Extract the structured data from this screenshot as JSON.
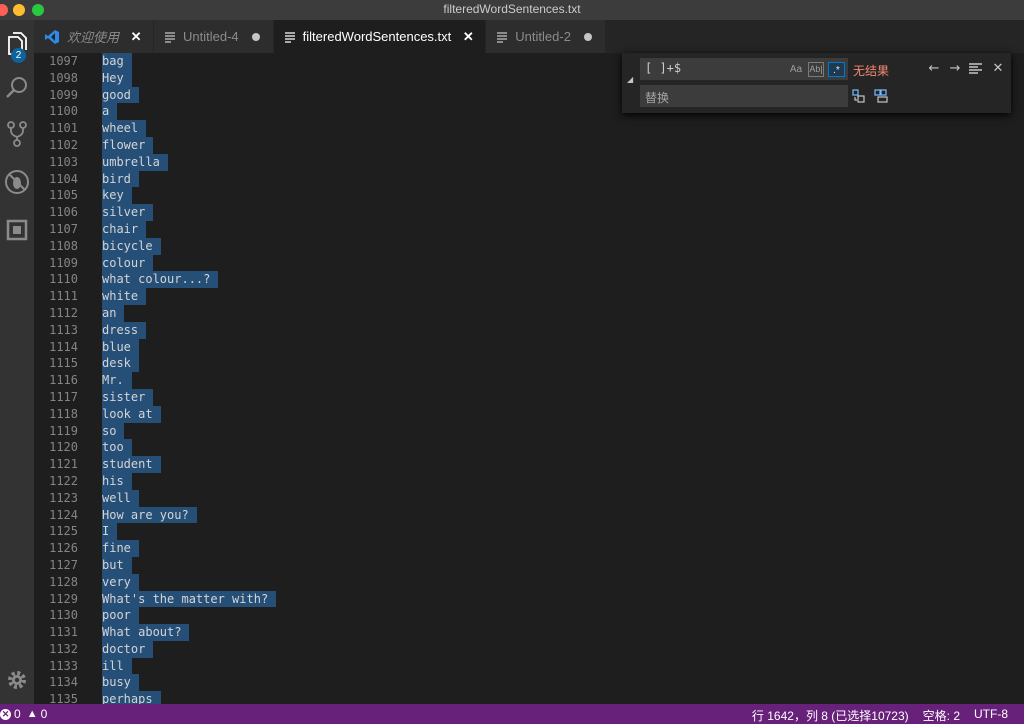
{
  "window": {
    "title": "filteredWordSentences.txt"
  },
  "activity_bar": {
    "explorer_badge": "2"
  },
  "tabs": [
    {
      "label": "欢迎使用",
      "icon": "vscode-logo-icon",
      "state": "close",
      "italic": true
    },
    {
      "label": "Untitled-4",
      "icon": "file-lines-icon",
      "state": "dirty"
    },
    {
      "label": "filteredWordSentences.txt",
      "icon": "file-lines-icon",
      "state": "close",
      "active": true
    },
    {
      "label": "Untitled-2",
      "icon": "file-lines-icon",
      "state": "dirty"
    }
  ],
  "editor": {
    "lines": [
      {
        "n": "1097",
        "text": "bag"
      },
      {
        "n": "1098",
        "text": "Hey"
      },
      {
        "n": "1099",
        "text": "good"
      },
      {
        "n": "1100",
        "text": "a"
      },
      {
        "n": "1101",
        "text": "wheel"
      },
      {
        "n": "1102",
        "text": "flower"
      },
      {
        "n": "1103",
        "text": "umbrella"
      },
      {
        "n": "1104",
        "text": "bird"
      },
      {
        "n": "1105",
        "text": "key"
      },
      {
        "n": "1106",
        "text": "silver"
      },
      {
        "n": "1107",
        "text": "chair"
      },
      {
        "n": "1108",
        "text": "bicycle"
      },
      {
        "n": "1109",
        "text": "colour"
      },
      {
        "n": "1110",
        "text": "what colour...?"
      },
      {
        "n": "1111",
        "text": "white"
      },
      {
        "n": "1112",
        "text": "an"
      },
      {
        "n": "1113",
        "text": "dress"
      },
      {
        "n": "1114",
        "text": "blue"
      },
      {
        "n": "1115",
        "text": "desk"
      },
      {
        "n": "1116",
        "text": "Mr."
      },
      {
        "n": "1117",
        "text": "sister"
      },
      {
        "n": "1118",
        "text": "look at"
      },
      {
        "n": "1119",
        "text": "so"
      },
      {
        "n": "1120",
        "text": "too"
      },
      {
        "n": "1121",
        "text": "student"
      },
      {
        "n": "1122",
        "text": "his"
      },
      {
        "n": "1123",
        "text": "well"
      },
      {
        "n": "1124",
        "text": "How are you?"
      },
      {
        "n": "1125",
        "text": "I"
      },
      {
        "n": "1126",
        "text": "fine"
      },
      {
        "n": "1127",
        "text": "but"
      },
      {
        "n": "1128",
        "text": "very"
      },
      {
        "n": "1129",
        "text": "What's the matter with?"
      },
      {
        "n": "1130",
        "text": "poor"
      },
      {
        "n": "1131",
        "text": "What about?"
      },
      {
        "n": "1132",
        "text": "doctor"
      },
      {
        "n": "1133",
        "text": "ill"
      },
      {
        "n": "1134",
        "text": "busy"
      },
      {
        "n": "1135",
        "text": "perhaps"
      }
    ]
  },
  "find_widget": {
    "find_value": "[ ]+$",
    "match_case_label": "Aa",
    "whole_word_label": "Ab|",
    "regex_label": ".*",
    "result_text": "无结果",
    "replace_placeholder": "替换"
  },
  "status_bar": {
    "errors": "0",
    "warnings": "0",
    "position": "行 1642，列 8 (已选择10723)",
    "indent": "空格: 2",
    "encoding": "UTF-8"
  },
  "colors": {
    "status_bar": "#68217a",
    "selection": "#264f78",
    "no_result": "#f48771",
    "badge": "#0e639c"
  }
}
